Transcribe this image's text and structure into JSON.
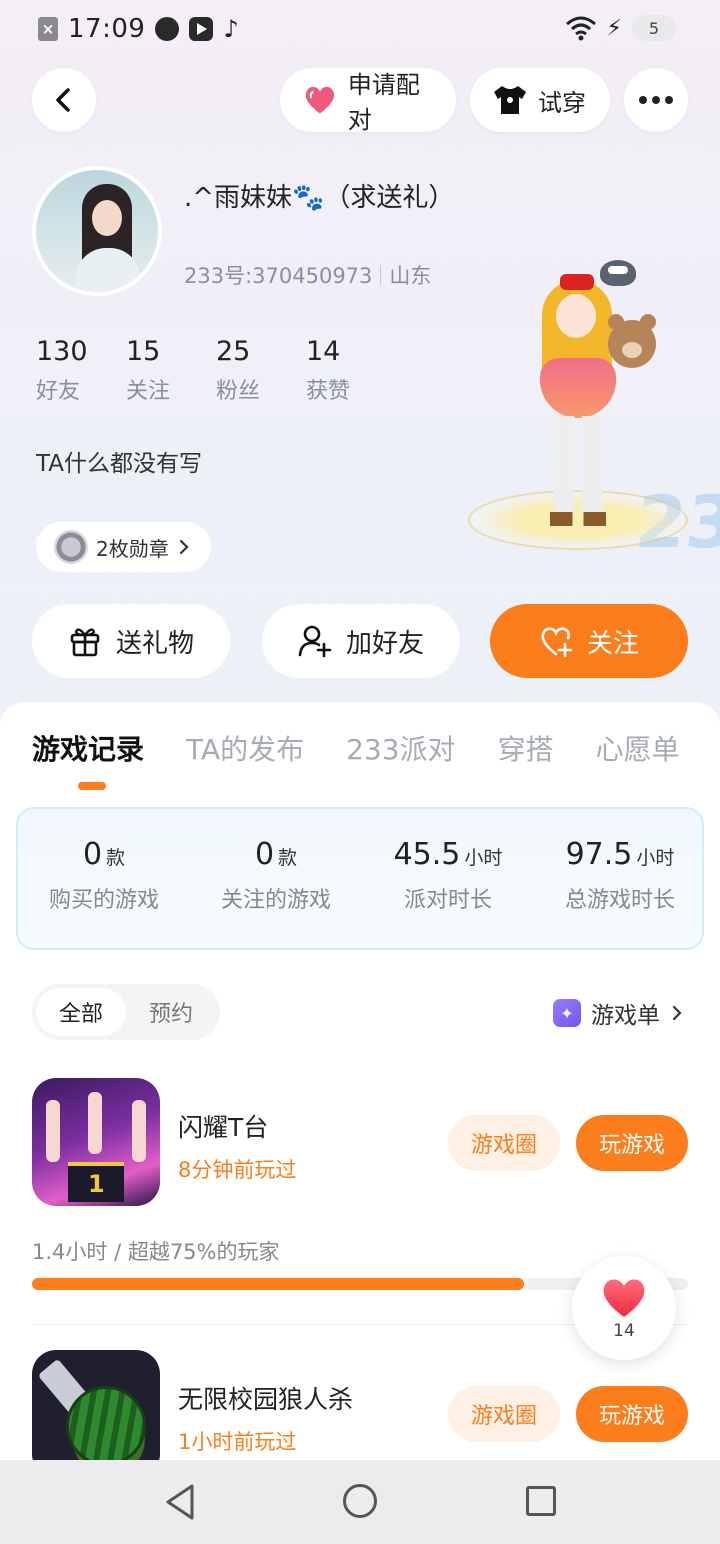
{
  "status_bar": {
    "time": "17:09",
    "battery": "5"
  },
  "header": {
    "pair_label": "申请配对",
    "tryon_label": "试穿"
  },
  "profile": {
    "nickname": ".^雨妹妹🐾（求送礼）",
    "uid_label": "233号:370450973",
    "location": "山东",
    "stats": [
      {
        "value": "130",
        "label": "好友"
      },
      {
        "value": "15",
        "label": "关注"
      },
      {
        "value": "25",
        "label": "粉丝"
      },
      {
        "value": "14",
        "label": "获赞"
      }
    ],
    "bio": "TA什么都没有写",
    "medal_label": "2枚勋章"
  },
  "actions": {
    "gift": "送礼物",
    "add_friend": "加好友",
    "follow": "关注"
  },
  "tabs": [
    "游戏记录",
    "TA的发布",
    "233派对",
    "穿搭",
    "心愿单"
  ],
  "summary": [
    {
      "value": "0",
      "unit": "款",
      "label": "购买的游戏"
    },
    {
      "value": "0",
      "unit": "款",
      "label": "关注的游戏"
    },
    {
      "value": "45.5",
      "unit": "小时",
      "label": "派对时长"
    },
    {
      "value": "97.5",
      "unit": "小时",
      "label": "总游戏时长"
    }
  ],
  "filter": {
    "all": "全部",
    "reserve": "预约",
    "gamelist": "游戏单"
  },
  "games": [
    {
      "name": "闪耀T台",
      "last_played": "8分钟前玩过",
      "circle_label": "游戏圈",
      "play_label": "玩游戏",
      "progress_text": "1.4小时 / 超越75%的玩家",
      "progress": 0.75
    },
    {
      "name": "无限校园狼人杀",
      "last_played": "1小时前玩过",
      "circle_label": "游戏圈",
      "play_label": "玩游戏"
    }
  ],
  "like_count": "14",
  "colors": {
    "accent": "#fb7d1c",
    "accent_soft": "#fff0e5"
  }
}
